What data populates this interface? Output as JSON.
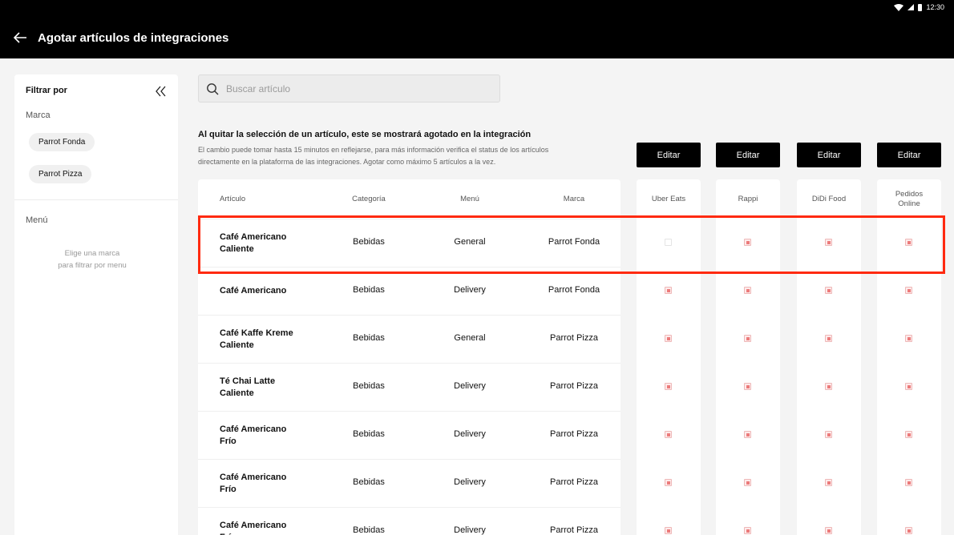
{
  "status": {
    "time": "12:30"
  },
  "header": {
    "title": "Agotar artículos de integraciones"
  },
  "sidebar": {
    "title": "Filtrar por",
    "brand_label": "Marca",
    "brands": [
      "Parrot Fonda",
      "Parrot Pizza"
    ],
    "menu_label": "Menú",
    "menu_hint_line1": "Elige una marca",
    "menu_hint_line2": "para filtrar por menu"
  },
  "search": {
    "placeholder": "Buscar artículo"
  },
  "info": {
    "title": "Al quitar la selección de un artículo, este se mostrará agotado en la integración",
    "desc_line1": "El cambio puede tomar hasta 15 minutos en reflejarse, para más información verifica el status de los artículos",
    "desc_line2": "directamente en la plataforma de las integraciones. Agotar como máximo 5 artículos a la vez."
  },
  "edit_label": "Editar",
  "table": {
    "columns": {
      "article": "Artículo",
      "category": "Categoría",
      "menu": "Menú",
      "brand": "Marca"
    },
    "integrations": {
      "uber": "Uber Eats",
      "rappi": "Rappi",
      "didi": "DiDi Food",
      "pedidos_1": "Pedidos",
      "pedidos_2": "Online"
    },
    "rows": [
      {
        "name1": "Café Americano",
        "name2": "Caliente",
        "category": "Bebidas",
        "menu": "General",
        "brand": "Parrot Fonda",
        "checks": [
          false,
          true,
          true,
          true
        ]
      },
      {
        "name1": "Café Americano",
        "name2": "",
        "category": "Bebidas",
        "menu": "Delivery",
        "brand": "Parrot Fonda",
        "checks": [
          true,
          true,
          true,
          true
        ]
      },
      {
        "name1": "Café Kaffe Kreme",
        "name2": "Caliente",
        "category": "Bebidas",
        "menu": "General",
        "brand": "Parrot Pizza",
        "checks": [
          true,
          true,
          true,
          true
        ]
      },
      {
        "name1": "Té Chai Latte",
        "name2": "Caliente",
        "category": "Bebidas",
        "menu": "Delivery",
        "brand": "Parrot Pizza",
        "checks": [
          true,
          true,
          true,
          true
        ]
      },
      {
        "name1": "Café Americano",
        "name2": "Frío",
        "category": "Bebidas",
        "menu": "Delivery",
        "brand": "Parrot Pizza",
        "checks": [
          true,
          true,
          true,
          true
        ]
      },
      {
        "name1": "Café Americano",
        "name2": "Frío",
        "category": "Bebidas",
        "menu": "Delivery",
        "brand": "Parrot Pizza",
        "checks": [
          true,
          true,
          true,
          true
        ]
      },
      {
        "name1": "Café Americano",
        "name2": "Frío",
        "category": "Bebidas",
        "menu": "Delivery",
        "brand": "Parrot Pizza",
        "checks": [
          true,
          true,
          true,
          true
        ]
      }
    ]
  },
  "colors": {
    "highlight": "#ff2a10",
    "checkbox_fill": "#ec7b7b",
    "topbar": "#000000"
  }
}
